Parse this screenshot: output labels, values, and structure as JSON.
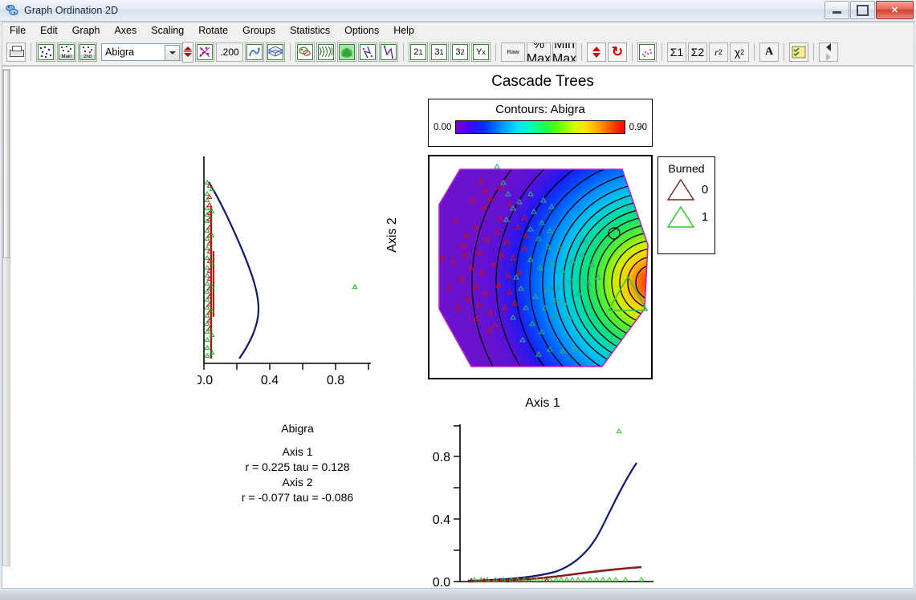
{
  "window": {
    "title": "Graph Ordination 2D",
    "app_icon": "graph-ordination-icon",
    "minimize_label": "Minimize",
    "restore_label": "Restore",
    "close_label": "✕"
  },
  "menu": {
    "items": [
      {
        "label": "File"
      },
      {
        "label": "Edit"
      },
      {
        "label": "Graph"
      },
      {
        "label": "Axes"
      },
      {
        "label": "Scaling"
      },
      {
        "label": "Rotate"
      },
      {
        "label": "Groups"
      },
      {
        "label": "Statistics"
      },
      {
        "label": "Options"
      },
      {
        "label": "Help"
      }
    ]
  },
  "toolbar": {
    "print_icon": "printer-icon",
    "scatter_plain_icon": "scatter-plot-icon",
    "scatter_main_icon": "scatter-main-icon",
    "scatter_main_label": "Main",
    "scatter_2nd_icon": "scatter-second-icon",
    "scatter_2nd_label": "2nd",
    "species_select": {
      "value": "Abigra",
      "dropdown_icon": "chevron-down-icon"
    },
    "spinner_icon": "up-down-spinner-icon",
    "overlay_icon": "overlay-points-icon",
    "threshold_value": ".200",
    "joinplot_icon": "join-plot-icon",
    "mesh_icon": "mesh-grid-icon",
    "biplot_icon": "biplot-icon",
    "weave_icon": "weave-surface-icon",
    "surface_icon": "surface-fill-icon",
    "vector_icon": "vector-overlay-icon",
    "vector2_icon": "vector-overlay-2-icon",
    "axis21_label": "2",
    "axis21_sub": "1",
    "axis31_label": "3",
    "axis31_sub": "1",
    "axis32_label": "3",
    "axis32_sub": "2",
    "axisyx_label": "Y",
    "axisyx_sub": "x",
    "raw_label": "Raw",
    "pctmax_top": "%",
    "pctmax_bottom": "Max",
    "minmax_top": "Min",
    "minmax_bottom": "Max",
    "arrows_icon": "up-down-arrows-icon",
    "refresh_icon": "refresh-icon",
    "points_icon": "points-box-icon",
    "sum1_label": "Σ1",
    "sum2_label": "Σ2",
    "r2_label": "r",
    "r2_sup": "2",
    "chi2_label": "χ",
    "chi2_sup": "2",
    "font_label": "A",
    "checklist_icon": "checklist-icon",
    "nav_icon": "step-back-icon"
  },
  "plot": {
    "title": "Cascade Trees",
    "colorbar": {
      "title": "Contours: Abigra",
      "min": "0.00",
      "max": "0.90"
    },
    "legend": {
      "title": "Burned",
      "entries": [
        {
          "value": "0",
          "color": "#8b1a1a",
          "marker": "triangle-outline"
        },
        {
          "value": "1",
          "color": "#22cc22",
          "marker": "triangle-outline"
        }
      ]
    },
    "axis1_label": "Axis 1",
    "axis2_label": "Axis 2",
    "left_axis_ticks": [
      "0.0",
      "0.4",
      "0.8"
    ],
    "bottom_axis_ticks": [
      "0.0",
      "0.4",
      "0.8"
    ]
  },
  "stats": {
    "variable": "Abigra",
    "axis1_header": "Axis 1",
    "axis1_line": "r =  0.225 tau =  0.128",
    "axis2_header": "Axis 2",
    "axis2_line": "r = -0.077 tau = -0.086"
  },
  "chart_data": {
    "type": "scatter",
    "title": "Cascade Trees",
    "xlabel": "Axis 1",
    "ylabel": "Axis 2",
    "colormap": "jet",
    "contour_variable": "Abigra",
    "contour_range": [
      0.0,
      0.9
    ],
    "groups": [
      {
        "name": "Burned 0",
        "color": "#8b1a1a",
        "marker": "triangle"
      },
      {
        "name": "Burned 1",
        "color": "#22cc22",
        "marker": "triangle"
      }
    ],
    "correlations": {
      "variable": "Abigra",
      "axis1": {
        "r": 0.225,
        "tau": 0.128
      },
      "axis2": {
        "r": -0.077,
        "tau": -0.086
      }
    },
    "left_panel": {
      "type": "line",
      "orientation": "vertical",
      "xlabel": "",
      "ylabel": "Axis 2",
      "xticks": [
        0.0,
        0.2,
        0.4,
        0.6,
        0.8,
        1.0
      ],
      "xticklabels": [
        "0.0",
        "",
        "0.4",
        "",
        "0.8",
        ""
      ],
      "xlim": [
        0.0,
        1.0
      ],
      "curve_color": "#101878",
      "curve_x": [
        0.04,
        0.1,
        0.17,
        0.22,
        0.26,
        0.3,
        0.33,
        0.35,
        0.34,
        0.3,
        0.22,
        0.14
      ],
      "curve_y": [
        1.0,
        0.93,
        0.84,
        0.74,
        0.63,
        0.5,
        0.38,
        0.28,
        0.18,
        0.1,
        0.04,
        0.0
      ]
    },
    "bottom_panel": {
      "type": "line",
      "xlabel": "Axis 1",
      "ylabel": "",
      "yticks": [
        0.0,
        0.4,
        0.8
      ],
      "yticklabels": [
        "0.0",
        "0.4",
        "0.8"
      ],
      "ylim": [
        0.0,
        1.0
      ],
      "series": [
        {
          "name": "fit-blue",
          "color": "#101878",
          "x": [
            0.0,
            0.1,
            0.2,
            0.3,
            0.4,
            0.5,
            0.58,
            0.65,
            0.72,
            0.8,
            0.88,
            0.95
          ],
          "y": [
            0.005,
            0.006,
            0.008,
            0.012,
            0.02,
            0.04,
            0.075,
            0.135,
            0.23,
            0.36,
            0.52,
            0.69
          ]
        },
        {
          "name": "fit-red",
          "color": "#8b1a1a",
          "x": [
            0.0,
            0.2,
            0.4,
            0.55,
            0.7,
            0.85,
            0.95
          ],
          "y": [
            0.004,
            0.006,
            0.01,
            0.022,
            0.038,
            0.052,
            0.062
          ]
        }
      ],
      "outlier_point": {
        "x": 0.73,
        "y": 0.97,
        "color": "#22cc22"
      }
    }
  }
}
